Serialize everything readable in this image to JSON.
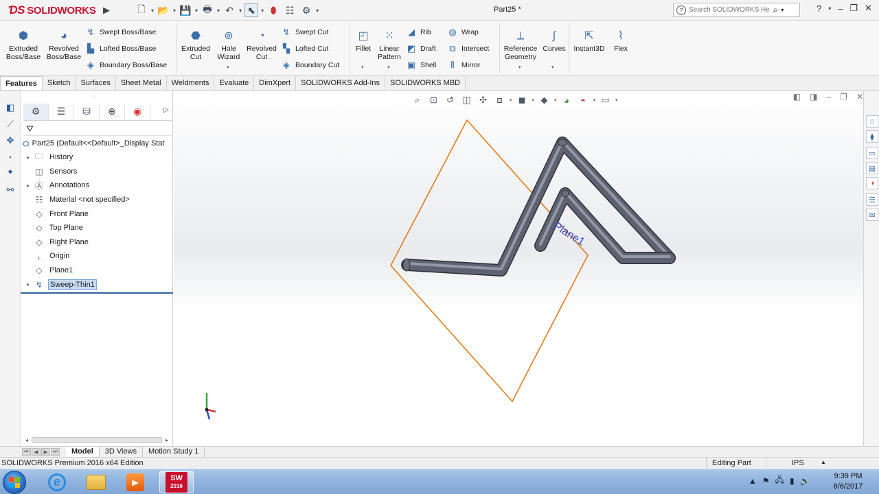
{
  "app": {
    "logo_text": "SOLIDWORKS",
    "document_title": "Part25 *"
  },
  "search": {
    "placeholder": "Search SOLIDWORKS Help"
  },
  "command_manager": {
    "extruded_boss": "Extruded\nBoss/Base",
    "revolved_boss": "Revolved\nBoss/Base",
    "swept_boss": "Swept Boss/Base",
    "lofted_boss": "Lofted Boss/Base",
    "boundary_boss": "Boundary Boss/Base",
    "extruded_cut": "Extruded\nCut",
    "hole_wizard": "Hole\nWizard",
    "revolved_cut": "Revolved\nCut",
    "swept_cut": "Swept Cut",
    "lofted_cut": "Lofted Cut",
    "boundary_cut": "Boundary Cut",
    "fillet": "Fillet",
    "linear_pattern": "Linear\nPattern",
    "rib": "Rib",
    "draft": "Draft",
    "shell": "Shell",
    "wrap": "Wrap",
    "intersect": "Intersect",
    "mirror": "Mirror",
    "reference_geometry": "Reference\nGeometry",
    "curves": "Curves",
    "instant3d": "Instant3D",
    "flex": "Flex"
  },
  "tabs": [
    "Features",
    "Sketch",
    "Surfaces",
    "Sheet Metal",
    "Weldments",
    "Evaluate",
    "DimXpert",
    "SOLIDWORKS Add-Ins",
    "SOLIDWORKS MBD"
  ],
  "feature_tree": {
    "root": "Part25  (Default<<Default>_Display Stat",
    "items": [
      {
        "label": "History",
        "icon": "history-folder-icon",
        "expandable": true
      },
      {
        "label": "Sensors",
        "icon": "sensors-icon",
        "expandable": false
      },
      {
        "label": "Annotations",
        "icon": "annotations-icon",
        "expandable": true
      },
      {
        "label": "Material <not specified>",
        "icon": "material-icon",
        "expandable": false
      },
      {
        "label": "Front Plane",
        "icon": "plane-icon",
        "expandable": false
      },
      {
        "label": "Top Plane",
        "icon": "plane-icon",
        "expandable": false
      },
      {
        "label": "Right Plane",
        "icon": "plane-icon",
        "expandable": false
      },
      {
        "label": "Origin",
        "icon": "origin-icon",
        "expandable": false
      },
      {
        "label": "Plane1",
        "icon": "plane-icon",
        "expandable": false
      },
      {
        "label": "Sweep-Thin1",
        "icon": "sweep-icon",
        "expandable": true,
        "selected": true
      }
    ]
  },
  "viewport": {
    "plane_label": "Plane1",
    "plane_color": "#e07b1a",
    "tube_color": "#5d6170"
  },
  "bottom_tabs": [
    "Model",
    "3D Views",
    "Motion Study 1"
  ],
  "status": {
    "edition": "SOLIDWORKS Premium 2016 x64 Edition",
    "mode": "Editing Part",
    "units": "IPS"
  },
  "taskbar": {
    "sw_badge_top": "SW",
    "sw_badge_bottom": "2016",
    "time": "9:39 PM",
    "date": "6/6/2017"
  }
}
